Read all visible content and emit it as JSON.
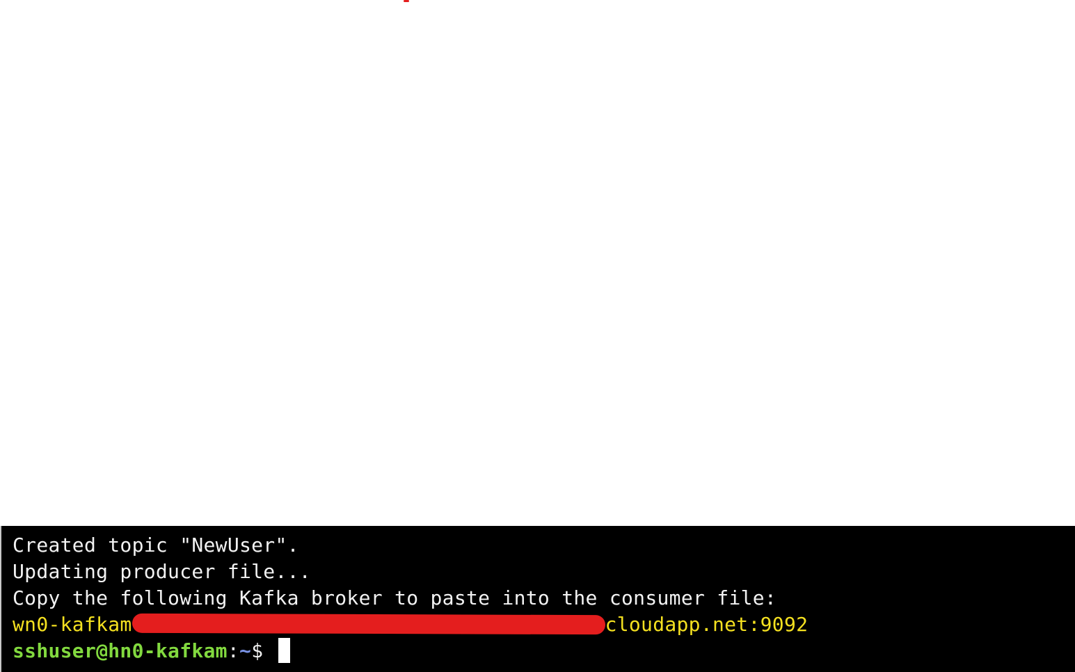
{
  "terminal": {
    "lines": [
      "Created topic \"NewUser\".",
      "Updating producer file...",
      "Copy the following Kafka broker to paste into the consumer file:"
    ],
    "broker": {
      "prefix": "wn0-kafkam",
      "suffix": "cloudapp.net:9092"
    },
    "prompt": {
      "user_host": "sshuser@hn0-kafkam",
      "colon": ":",
      "path": "~",
      "symbol": "$ "
    }
  },
  "colors": {
    "background": "#000000",
    "text": "#f2f2f2",
    "broker": "#f4e020",
    "user_host": "#82d93f",
    "path": "#7a93e6",
    "redaction": "#e41e1e"
  }
}
